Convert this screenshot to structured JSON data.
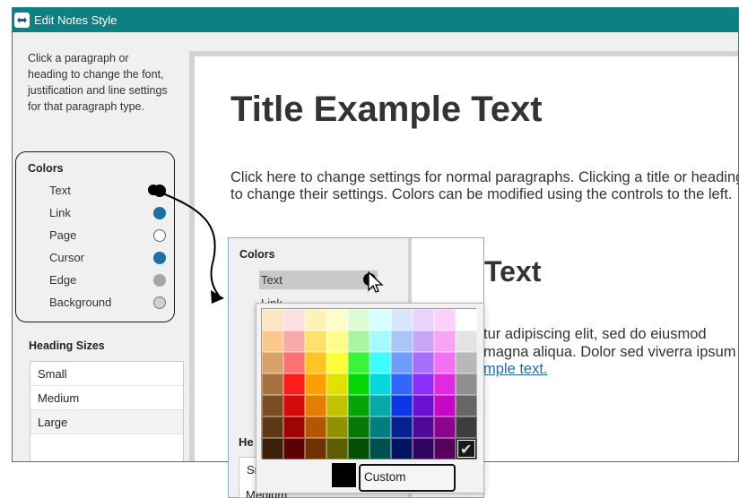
{
  "window": {
    "title": "Edit Notes Style"
  },
  "left_panel": {
    "intro": "Click a paragraph or heading to change the font, justification and line settings for that paragraph type.",
    "colors_title": "Colors",
    "colors": [
      {
        "label": "Text",
        "color": "#000000"
      },
      {
        "label": "Link",
        "color": "#1d6fa5"
      },
      {
        "label": "Page",
        "color": "#ffffff"
      },
      {
        "label": "Cursor",
        "color": "#1d6fa5"
      },
      {
        "label": "Edge",
        "color": "#a6a6a6"
      },
      {
        "label": "Background",
        "color": "#d0d0d0"
      }
    ],
    "heading_sizes_title": "Heading Sizes",
    "heading_sizes": [
      "Small",
      "Medium",
      "Large"
    ],
    "selected_size": "Large"
  },
  "preview": {
    "title": "Title Example Text",
    "paragraph": "Click here to change settings for normal paragraphs. Clicking a title or heading to change their settings. Colors can be modified using the controls to the left.",
    "heading_fragment": "Text",
    "lorem_line1": "tur adipiscing elit, sed do eiusmod",
    "lorem_line2": "magna aliqua. Dolor sed viverra ipsum",
    "link_fragment": "mple text."
  },
  "inset": {
    "colors_title": "Colors",
    "text_label": "Text",
    "link_label": "Link",
    "heading_fragment": "He",
    "size_fragment_1": "Sr",
    "size_fragment_2": "Medium"
  },
  "color_picker": {
    "custom_label": "Custom",
    "current_color": "#000000",
    "checked_color": "#1a1a1a",
    "palette": [
      [
        "#fde6c4",
        "#fce0e0",
        "#fdf3b6",
        "#fefec8",
        "#dcfcd4",
        "#d7fefe",
        "#d8e6fd",
        "#e6d4fd",
        "#fccffd",
        "#ffffff"
      ],
      [
        "#f9c98e",
        "#f7a8a8",
        "#fce26b",
        "#fdfd8c",
        "#aaf6a0",
        "#a4fbfb",
        "#a8c6f8",
        "#c8a8f6",
        "#f7a4f7",
        "#e3e3e3"
      ],
      [
        "#d8a168",
        "#fd7073",
        "#ffc424",
        "#fdfd3a",
        "#3af43a",
        "#3efcfc",
        "#6e9cfb",
        "#a870fa",
        "#f46ff4",
        "#b8b8b8"
      ],
      [
        "#a6713e",
        "#fc1c1c",
        "#fd9f00",
        "#e1e100",
        "#06d806",
        "#05d8d8",
        "#3366fd",
        "#8a2ef9",
        "#e129e1",
        "#8f8f8f"
      ],
      [
        "#7c4c23",
        "#d40b0b",
        "#e47d00",
        "#c2c200",
        "#06a506",
        "#04a9a9",
        "#0a37e3",
        "#6b10d4",
        "#c706c7",
        "#666666"
      ],
      [
        "#5e3813",
        "#9d0505",
        "#b25600",
        "#929200",
        "#047a04",
        "#037d7d",
        "#05238f",
        "#4e0a97",
        "#8c048c",
        "#3d3d3d"
      ],
      [
        "#3b1f08",
        "#5b0202",
        "#6e3200",
        "#5d5d00",
        "#034f03",
        "#024f4f",
        "#02145f",
        "#300463",
        "#57025a",
        "#1a1a1a"
      ]
    ]
  }
}
